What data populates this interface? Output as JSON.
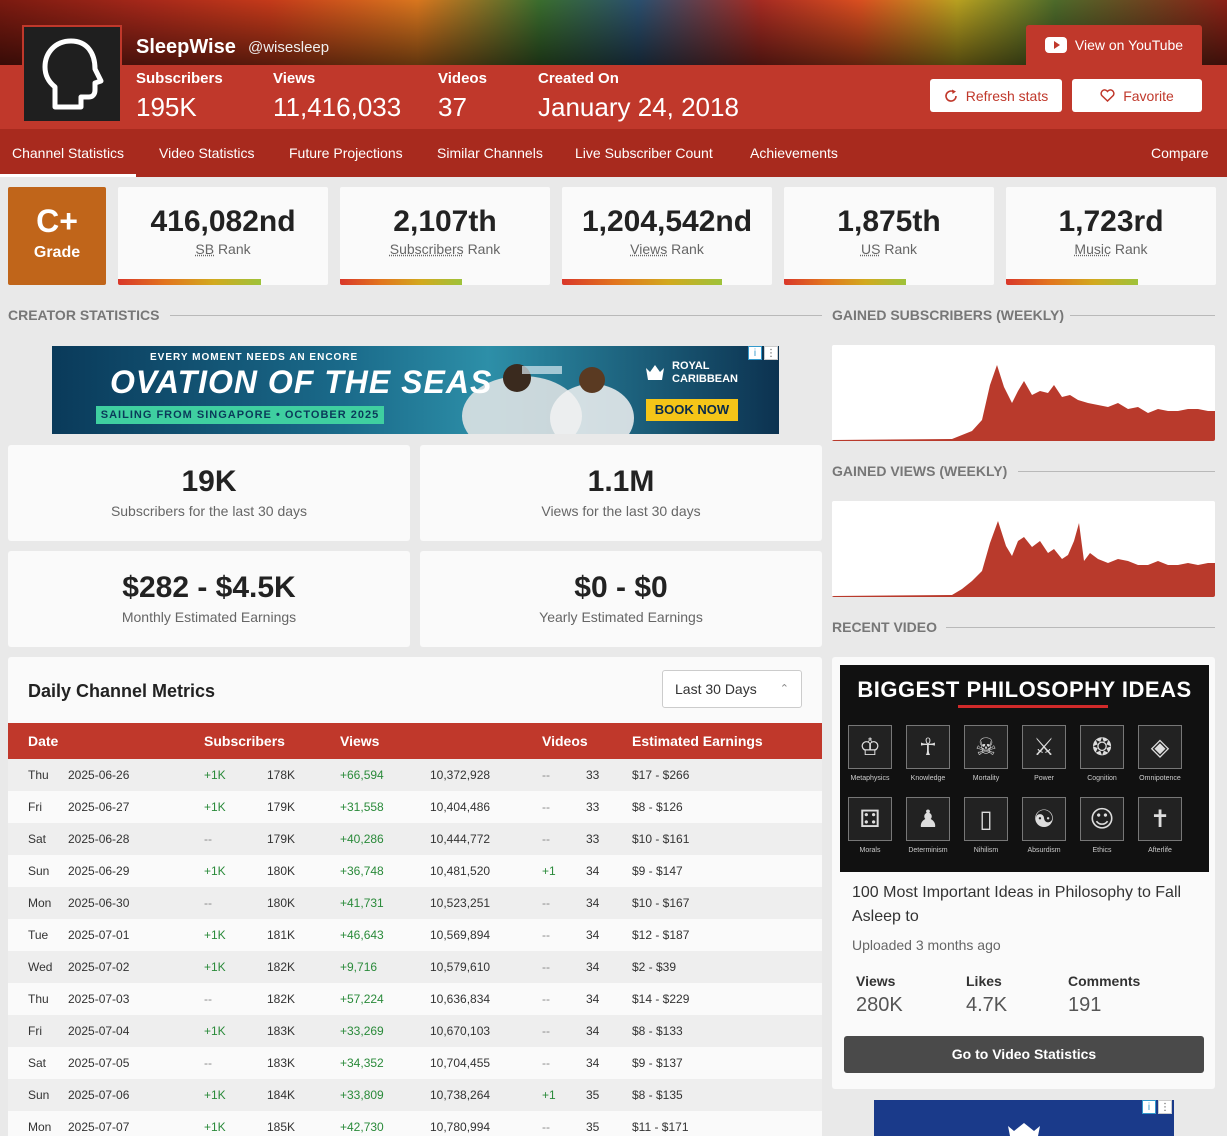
{
  "channel": {
    "name": "SleepWise",
    "handle": "@wisesleep",
    "stats": [
      {
        "label": "Subscribers",
        "value": "195K"
      },
      {
        "label": "Views",
        "value": "11,416,033"
      },
      {
        "label": "Videos",
        "value": "37"
      },
      {
        "label": "Created On",
        "value": "January 24, 2018"
      }
    ]
  },
  "buttons": {
    "youtube": "View on YouTube",
    "refresh": "Refresh stats",
    "favorite": "Favorite"
  },
  "nav": {
    "items": [
      "Channel Statistics",
      "Video Statistics",
      "Future Projections",
      "Similar Channels",
      "Live Subscriber Count",
      "Achievements"
    ],
    "compare": "Compare"
  },
  "grade": {
    "value": "C+",
    "label": "Grade"
  },
  "ranks": [
    {
      "value": "416,082nd",
      "key": "SB",
      "suffix": "Rank",
      "fill": 0.68
    },
    {
      "value": "2,107th",
      "key": "Subscribers",
      "suffix": "Rank",
      "fill": 0.58
    },
    {
      "value": "1,204,542nd",
      "key": "Views",
      "suffix": "Rank",
      "fill": 0.76
    },
    {
      "value": "1,875th",
      "key": "US",
      "suffix": "Rank",
      "fill": 0.58
    },
    {
      "value": "1,723rd",
      "key": "Music",
      "suffix": "Rank",
      "fill": 0.63
    }
  ],
  "sections": {
    "creator": "CREATOR STATISTICS",
    "gained_subs": "GAINED SUBSCRIBERS (WEEKLY)",
    "gained_views": "GAINED VIEWS (WEEKLY)",
    "recent": "RECENT VIDEO"
  },
  "ad": {
    "top": "EVERY MOMENT NEEDS AN ENCORE",
    "headline": "OVATION OF THE SEAS",
    "strip": "SAILING FROM SINGAPORE • OCTOBER 2025",
    "brand": "ROYAL CARIBBEAN",
    "cta": "BOOK NOW"
  },
  "creator_boxes": [
    {
      "value": "19K",
      "label": "Subscribers for the last 30 days"
    },
    {
      "value": "1.1M",
      "label": "Views for the last 30 days"
    },
    {
      "value": "$282 - $4.5K",
      "label": "Monthly Estimated Earnings"
    },
    {
      "value": "$0 - $0",
      "label": "Yearly Estimated Earnings"
    }
  ],
  "metrics": {
    "title": "Daily Channel Metrics",
    "range": "Last 30 Days",
    "headers": [
      "Date",
      "Subscribers",
      "Views",
      "Videos",
      "Estimated Earnings"
    ],
    "rows": [
      {
        "day": "Thu",
        "date": "2025-06-26",
        "sub_delta": "+1K",
        "subs": "178K",
        "view_delta": "+66,594",
        "views": "10,372,928",
        "vid_delta": "--",
        "videos": "33",
        "earn": "$17 - $266"
      },
      {
        "day": "Fri",
        "date": "2025-06-27",
        "sub_delta": "+1K",
        "subs": "179K",
        "view_delta": "+31,558",
        "views": "10,404,486",
        "vid_delta": "--",
        "videos": "33",
        "earn": "$8 - $126"
      },
      {
        "day": "Sat",
        "date": "2025-06-28",
        "sub_delta": "--",
        "subs": "179K",
        "view_delta": "+40,286",
        "views": "10,444,772",
        "vid_delta": "--",
        "videos": "33",
        "earn": "$10 - $161"
      },
      {
        "day": "Sun",
        "date": "2025-06-29",
        "sub_delta": "+1K",
        "subs": "180K",
        "view_delta": "+36,748",
        "views": "10,481,520",
        "vid_delta": "+1",
        "videos": "34",
        "earn": "$9 - $147"
      },
      {
        "day": "Mon",
        "date": "2025-06-30",
        "sub_delta": "--",
        "subs": "180K",
        "view_delta": "+41,731",
        "views": "10,523,251",
        "vid_delta": "--",
        "videos": "34",
        "earn": "$10 - $167"
      },
      {
        "day": "Tue",
        "date": "2025-07-01",
        "sub_delta": "+1K",
        "subs": "181K",
        "view_delta": "+46,643",
        "views": "10,569,894",
        "vid_delta": "--",
        "videos": "34",
        "earn": "$12 - $187"
      },
      {
        "day": "Wed",
        "date": "2025-07-02",
        "sub_delta": "+1K",
        "subs": "182K",
        "view_delta": "+9,716",
        "views": "10,579,610",
        "vid_delta": "--",
        "videos": "34",
        "earn": "$2 - $39"
      },
      {
        "day": "Thu",
        "date": "2025-07-03",
        "sub_delta": "--",
        "subs": "182K",
        "view_delta": "+57,224",
        "views": "10,636,834",
        "vid_delta": "--",
        "videos": "34",
        "earn": "$14 - $229"
      },
      {
        "day": "Fri",
        "date": "2025-07-04",
        "sub_delta": "+1K",
        "subs": "183K",
        "view_delta": "+33,269",
        "views": "10,670,103",
        "vid_delta": "--",
        "videos": "34",
        "earn": "$8 - $133"
      },
      {
        "day": "Sat",
        "date": "2025-07-05",
        "sub_delta": "--",
        "subs": "183K",
        "view_delta": "+34,352",
        "views": "10,704,455",
        "vid_delta": "--",
        "videos": "34",
        "earn": "$9 - $137"
      },
      {
        "day": "Sun",
        "date": "2025-07-06",
        "sub_delta": "+1K",
        "subs": "184K",
        "view_delta": "+33,809",
        "views": "10,738,264",
        "vid_delta": "+1",
        "videos": "35",
        "earn": "$8 - $135"
      },
      {
        "day": "Mon",
        "date": "2025-07-07",
        "sub_delta": "+1K",
        "subs": "185K",
        "view_delta": "+42,730",
        "views": "10,780,994",
        "vid_delta": "--",
        "videos": "35",
        "earn": "$11 - $171"
      }
    ]
  },
  "recent_video": {
    "thumb_title": "BIGGEST PHILOSOPHY IDEAS",
    "thumb_tiles": [
      "Metaphysics",
      "Knowledge",
      "Mortality",
      "Power",
      "Cognition",
      "Omnipotence",
      "Morals",
      "Determinism",
      "Nihilism",
      "Absurdism",
      "Ethics",
      "Afterlife"
    ],
    "title": "100 Most Important Ideas in Philosophy to Fall Asleep to",
    "uploaded": "Uploaded 3 months ago",
    "stats": [
      {
        "label": "Views",
        "value": "280K"
      },
      {
        "label": "Likes",
        "value": "4.7K"
      },
      {
        "label": "Comments",
        "value": "191"
      }
    ],
    "button": "Go to Video Statistics"
  },
  "colors": {
    "brand_red": "#c0382b",
    "nav_red": "#a82a1e",
    "grade_orange": "#c0651a",
    "chart_red": "#b93a2c"
  }
}
